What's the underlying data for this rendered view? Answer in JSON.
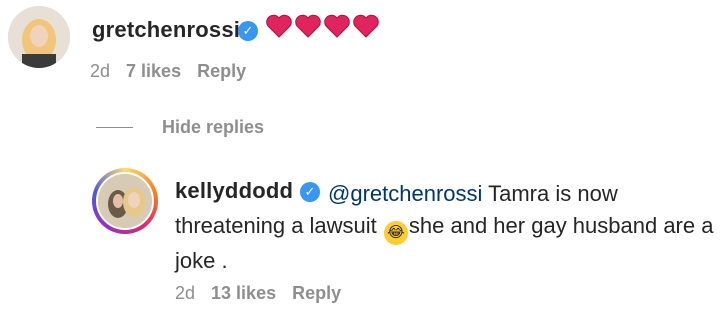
{
  "comment": {
    "username": "gretchenrossi",
    "body_icons": [
      "heart-icon",
      "heart-icon",
      "heart-icon",
      "heart-icon"
    ],
    "heart_color": "#e0245e",
    "time": "2d",
    "likes": "7 likes",
    "reply_label": "Reply"
  },
  "hide_replies_label": "Hide replies",
  "reply": {
    "username": "kellyddodd",
    "mention": "@gretchenrossi",
    "text_before_emoji": " Tamra is now threatening a lawsuit ",
    "emoji": "😂",
    "text_after_emoji": "she and her gay husband are a joke .",
    "time": "2d",
    "likes": "13 likes",
    "reply_label": "Reply"
  },
  "colors": {
    "verified": "#3897f0",
    "meta_text": "#8e8e8e",
    "mention": "#00376b"
  }
}
